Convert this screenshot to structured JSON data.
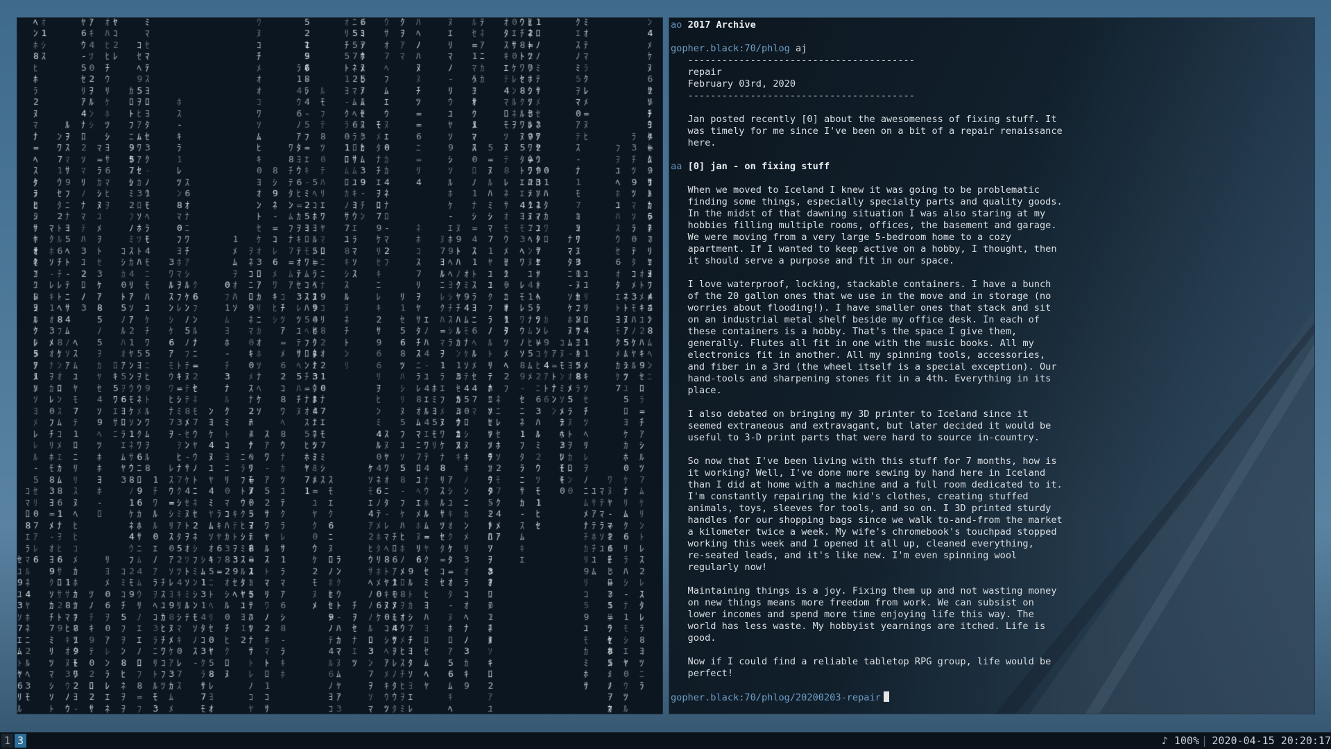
{
  "gopher": {
    "lines": [
      {
        "sel": "ao",
        "text": "2017 Archive",
        "cls": "hdr"
      },
      {
        "sel": "",
        "text": ""
      },
      {
        "sel": "",
        "url": "gopher.black:70/phlog",
        "text": " aj"
      },
      {
        "sel": "",
        "text": "   ----------------------------------------"
      },
      {
        "sel": "",
        "text": "   repair"
      },
      {
        "sel": "",
        "text": "   February 03rd, 2020"
      },
      {
        "sel": "",
        "text": "   ----------------------------------------"
      },
      {
        "sel": "",
        "text": ""
      },
      {
        "sel": "",
        "text": "   Jan posted recently [0] about the awesomeness of fixing stuff. It"
      },
      {
        "sel": "",
        "text": "   was timely for me since I've been on a bit of a repair renaissance"
      },
      {
        "sel": "",
        "text": "   here."
      },
      {
        "sel": "",
        "text": ""
      },
      {
        "sel": "aa",
        "text": "[0] jan - on fixing stuff",
        "cls": "hdr"
      },
      {
        "sel": "",
        "text": ""
      },
      {
        "sel": "",
        "text": "   When we moved to Iceland I knew it was going to be problematic"
      },
      {
        "sel": "",
        "text": "   finding some things, especially specialty parts and quality goods."
      },
      {
        "sel": "",
        "text": "   In the midst of that dawning situation I was also staring at my"
      },
      {
        "sel": "",
        "text": "   hobbies filling multiple rooms, offices, the basement and garage."
      },
      {
        "sel": "",
        "text": "   We were moving from a very large 5-bedroom home to a cozy"
      },
      {
        "sel": "",
        "text": "   apartment. If I wanted to keep active on a hobby, I thought, then"
      },
      {
        "sel": "",
        "text": "   it should serve a purpose and fit in our space."
      },
      {
        "sel": "",
        "text": ""
      },
      {
        "sel": "",
        "text": "   I love waterproof, locking, stackable containers. I have a bunch"
      },
      {
        "sel": "",
        "text": "   of the 20 gallon ones that we use in the move and in storage (no"
      },
      {
        "sel": "",
        "text": "   worries about flooding!). I have smaller ones that stack and sit"
      },
      {
        "sel": "",
        "text": "   on an industrial metal shelf beside my office desk. In each of"
      },
      {
        "sel": "",
        "text": "   these containers is a hobby. That's the space I give them,"
      },
      {
        "sel": "",
        "text": "   generally. Flutes all fit in one with the music books. All my"
      },
      {
        "sel": "",
        "text": "   electronics fit in another. All my spinning tools, accessories,"
      },
      {
        "sel": "",
        "text": "   and fiber in a 3rd (the wheel itself is a special exception). Our"
      },
      {
        "sel": "",
        "text": "   hand-tools and sharpening stones fit in a 4th. Everything in its"
      },
      {
        "sel": "",
        "text": "   place."
      },
      {
        "sel": "",
        "text": ""
      },
      {
        "sel": "",
        "text": "   I also debated on bringing my 3D printer to Iceland since it"
      },
      {
        "sel": "",
        "text": "   seemed extraneous and extravagant, but later decided it would be"
      },
      {
        "sel": "",
        "text": "   useful to 3-D print parts that were hard to source in-country."
      },
      {
        "sel": "",
        "text": ""
      },
      {
        "sel": "",
        "text": "   So now that I've been living with this stuff for 7 months, how is"
      },
      {
        "sel": "",
        "text": "   it working? Well, I've done more sewing by hand here in Iceland"
      },
      {
        "sel": "",
        "text": "   than I did at home with a machine and a full room dedicated to it."
      },
      {
        "sel": "",
        "text": "   I'm constantly repairing the kid's clothes, creating stuffed"
      },
      {
        "sel": "",
        "text": "   animals, toys, sleeves for tools, and so on. I 3D printed sturdy"
      },
      {
        "sel": "",
        "text": "   handles for our shopping bags since we walk to-and-from the market"
      },
      {
        "sel": "",
        "text": "   a kilometer twice a week. My wife's chromebook's touchpad stopped"
      },
      {
        "sel": "",
        "text": "   working this week and I opened it all up, cleaned everything,"
      },
      {
        "sel": "",
        "text": "   re-seated leads, and it's like new. I'm even spinning wool"
      },
      {
        "sel": "",
        "text": "   regularly now!"
      },
      {
        "sel": "",
        "text": ""
      },
      {
        "sel": "",
        "text": "   Maintaining things is a joy. Fixing them up and not wasting money"
      },
      {
        "sel": "",
        "text": "   on new things means more freedom from work. We can subsist on"
      },
      {
        "sel": "",
        "text": "   lower incomes and spend more time enjoying life this way. The"
      },
      {
        "sel": "",
        "text": "   world has less waste. My hobbyist yearnings are itched. Life is"
      },
      {
        "sel": "",
        "text": "   good."
      },
      {
        "sel": "",
        "text": ""
      },
      {
        "sel": "",
        "text": "   Now if I could find a reliable tabletop RPG group, life would be"
      },
      {
        "sel": "",
        "text": "   perfect!"
      },
      {
        "sel": "",
        "text": ""
      }
    ],
    "prompt": "gopher.black:70/phlog/20200203-repair"
  },
  "taskbar": {
    "workspace_1": "1",
    "workspace_2": "3",
    "volume": "♪ 100%",
    "separator": "|",
    "clock": "2020-04-15 20:20:17"
  },
  "colors": {
    "accent": "#2d6e9a",
    "link": "#6f9fc7",
    "terminal_bg": "#0c1621",
    "matrix_glyph": "#dfe6ea"
  }
}
